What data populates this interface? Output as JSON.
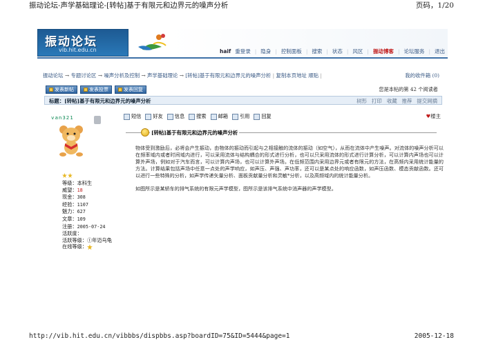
{
  "pdf": {
    "header_left": "振动论坛-声学基础理论-[转帖]基于有限元和边界元的噪声分析",
    "header_right": "页码，1/20",
    "footer_url": "http://vib.hit.edu.cn/vibbbs/dispbbs.asp?boardID=75&ID=5444&page=1",
    "footer_date": "2005-12-18"
  },
  "site": {
    "logo_title": "振动论坛",
    "logo_url": "vib.hit.edu.cn"
  },
  "topnav": {
    "user": "haif",
    "items": [
      "重登录",
      "隐身",
      "控制面板",
      "搜索",
      "状态",
      "风区",
      "振动博客",
      "论坛服务",
      "退出"
    ]
  },
  "breadcrumb": {
    "items": [
      "振动论坛",
      "专题讨论区",
      "噪声分析及控制",
      "声学基础理论",
      "[转帖]基于有限元和边界元的噪声分析"
    ],
    "copy_link": "复制本页地址",
    "bookmark": "顺贴",
    "inbox": "我的收件箱 (0)"
  },
  "buttons": {
    "new_topic": "发表新帖",
    "new_poll": "发表投票",
    "reply": "发表回复"
  },
  "reader_count": "您是本帖的第 42 个阅读者",
  "title_bar": {
    "label": "标题：[转帖]基于有限元和边界元的噪声分析",
    "tools": [
      "树形",
      "打印",
      "收藏",
      "推荐",
      "提交网摘"
    ]
  },
  "author": {
    "name": "van321",
    "grade": "等级：本科生",
    "prestige_label": "威望：",
    "prestige": "18",
    "cash_label": "现金：",
    "cash": "308",
    "exp_label": "经验：",
    "exp": "1107",
    "charm_label": "魅力：",
    "charm": "627",
    "posts_label": "文章：",
    "posts": "109",
    "registered_label": "注册：",
    "registered": "2005-07-24",
    "activity": "活跃度：",
    "activity_level": "活跃等级：①年迈乌龟",
    "online": "在线等级："
  },
  "post_tools": [
    "短信",
    "好友",
    "信息",
    "搜索",
    "邮箱",
    "引用",
    "回复"
  ],
  "floor": "楼主",
  "post": {
    "title": "[转帖]基于有限元和边界元的噪声分析",
    "para1": "物体受到激励后，必将会产生振动，由物体的振动而引起与之相接触的流体的振动（如空气），从而在流体中产生噪声。对流体的噪声分析可以在频率域内或者时间域内进行，可以采用流体与结构耦合的形式进行分析，也可以只采用流体的形式进行计算分析，可以计算内声场也可以计算外声场，例如对于汽车而言，可以计算内声场，也可以计算外声场。在低频范围内采用边界元或者有限元的方法，在高频内采用统计能量的方法。计算结果包括声场中任意一点处的声学响应，如声压、声强、声功率，还可以是某点处的响应函数，如声压函数、模态贡献函数。还可以进行一些特殊的分析，如声学传递矢量分析、面板贡献量分析和灵敏*分析，以及高频域内的统计能量分析。",
    "para2": "如图所示是某轿车的排气系统的有限元声学模型，图所示是该排气系统中消声器的声学模型。"
  }
}
